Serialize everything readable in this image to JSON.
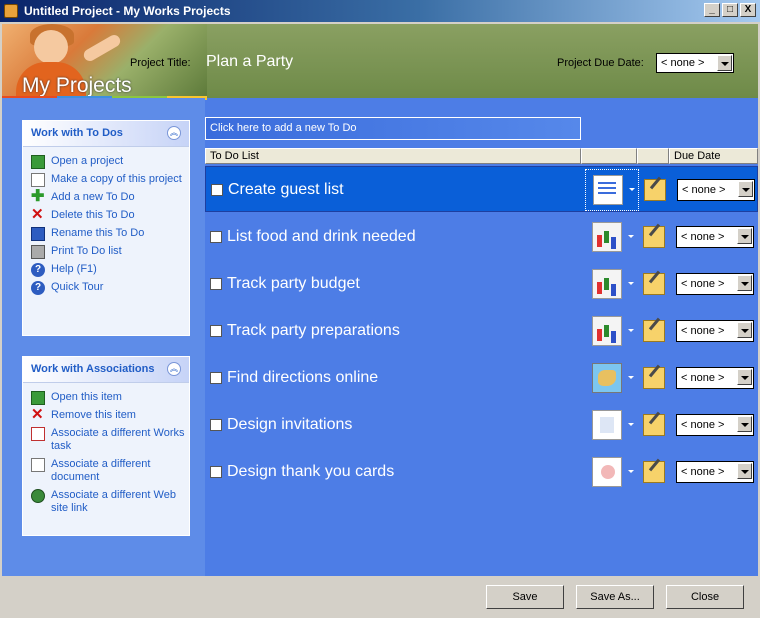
{
  "window": {
    "title": "Untitled Project - My Works Projects",
    "buttons": [
      "_",
      "□",
      "X"
    ]
  },
  "header": {
    "heading": "My Projects",
    "project_title_label": "Project Title:",
    "project_title_value": "Plan a Party",
    "due_date_label": "Project Due Date:",
    "due_date_value": "< none >"
  },
  "todos_pane": {
    "title": "Work with To Dos",
    "items": [
      {
        "label": "Open a project",
        "icon": "open-icon"
      },
      {
        "label": "Make a copy of this project",
        "icon": "copy-icon"
      },
      {
        "label": "Add a new To Do",
        "icon": "add-icon"
      },
      {
        "label": "Delete this To Do",
        "icon": "delete-icon"
      },
      {
        "label": "Rename this To Do",
        "icon": "rename-icon"
      },
      {
        "label": "Print To Do list",
        "icon": "print-icon"
      },
      {
        "label": "Help (F1)",
        "icon": "help-icon"
      },
      {
        "label": "Quick Tour",
        "icon": "tour-icon"
      }
    ]
  },
  "assoc_pane": {
    "title": "Work with Associations",
    "items": [
      {
        "label": "Open this item",
        "icon": "open-icon"
      },
      {
        "label": "Remove this item",
        "icon": "remove-icon"
      },
      {
        "label": "Associate a different Works task",
        "icon": "task-icon"
      },
      {
        "label": "Associate a different document",
        "icon": "document-icon"
      },
      {
        "label": "Associate a different Web site link",
        "icon": "web-icon"
      }
    ]
  },
  "list": {
    "new_todo_placeholder": "Click here to add a new To Do",
    "columns": {
      "todo": "To Do List",
      "due": "Due Date"
    },
    "items": [
      {
        "title": "Create guest list",
        "due": "< none >",
        "icon": "wizard-icon",
        "selected": true
      },
      {
        "title": "List food and drink needed",
        "due": "< none >",
        "icon": "chart-icon",
        "selected": false
      },
      {
        "title": "Track party budget",
        "due": "< none >",
        "icon": "chart-icon",
        "selected": false
      },
      {
        "title": "Track party preparations",
        "due": "< none >",
        "icon": "chart-icon",
        "selected": false
      },
      {
        "title": "Find directions online",
        "due": "< none >",
        "icon": "map-icon",
        "selected": false
      },
      {
        "title": "Design invitations",
        "due": "< none >",
        "icon": "document-icon",
        "selected": false
      },
      {
        "title": "Design thank you cards",
        "due": "< none >",
        "icon": "card-icon",
        "selected": false
      }
    ]
  },
  "footer": {
    "save": "Save",
    "save_as": "Save As...",
    "close": "Close"
  }
}
